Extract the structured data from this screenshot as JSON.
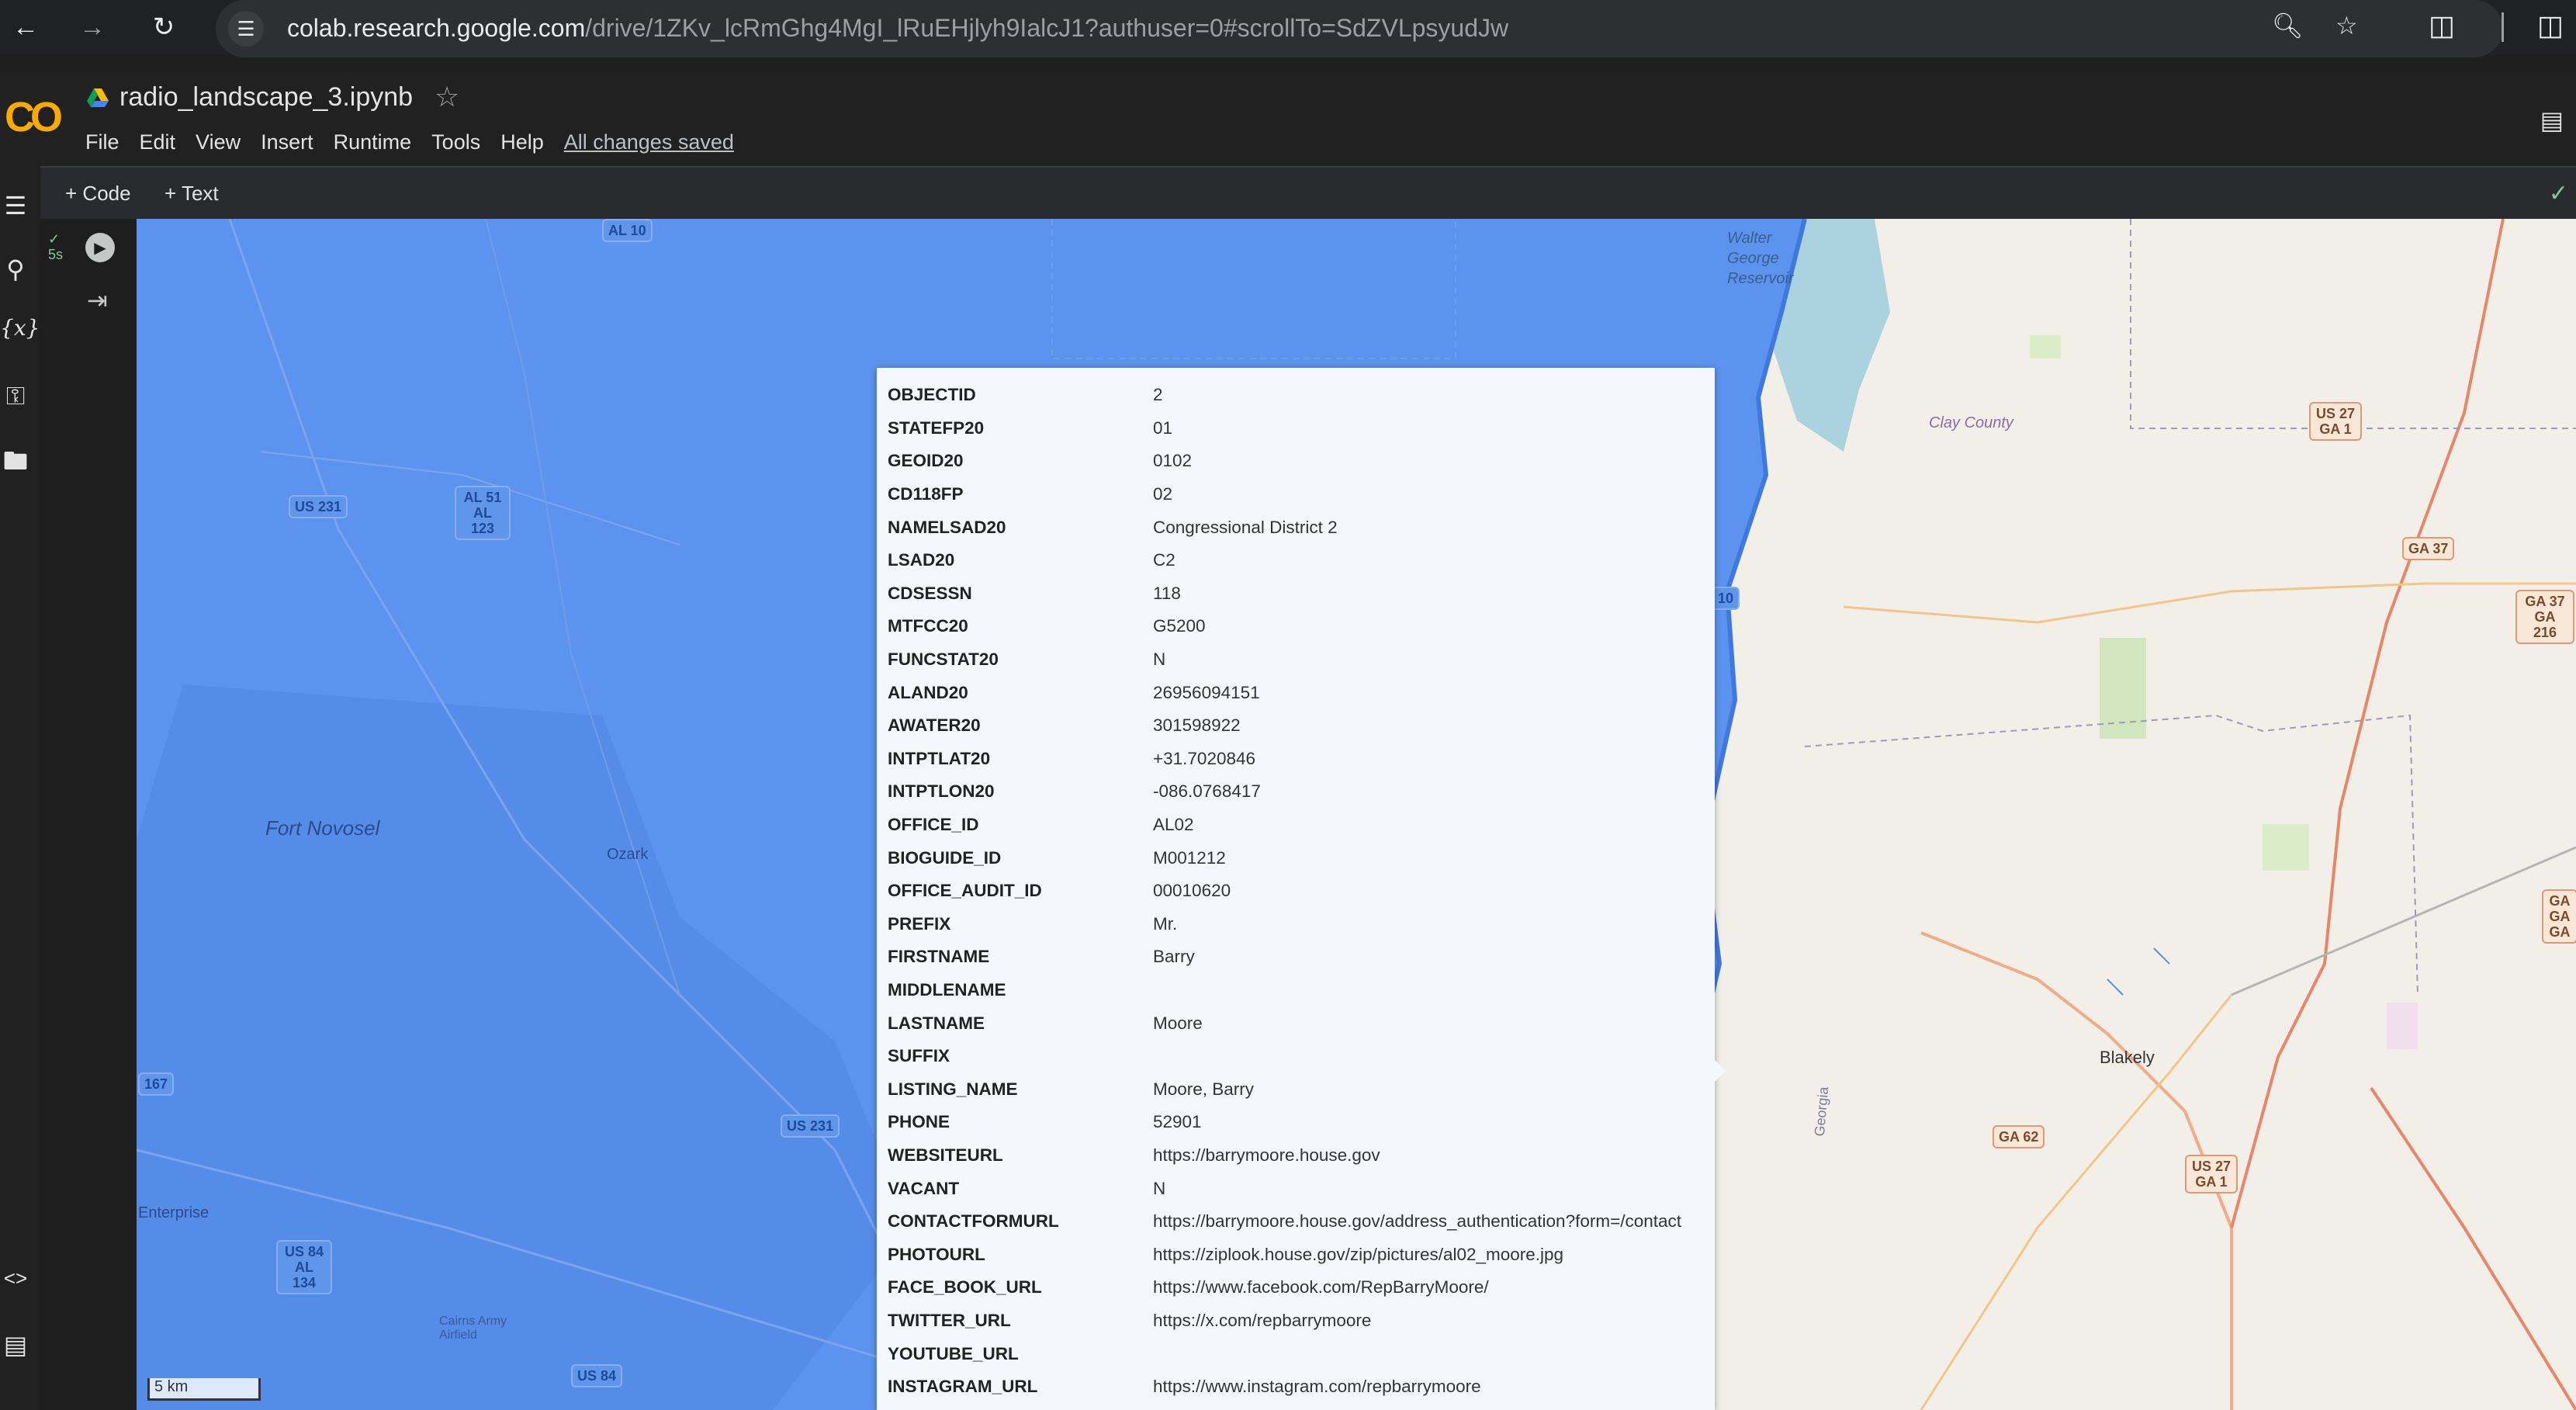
{
  "browser": {
    "url_host": "colab.research.google.com",
    "url_path": "/drive/1ZKv_lcRmGhg4MgI_lRuEHjlyh9IalcJ1?authuser=0#scrollTo=SdZVLpsyudJw"
  },
  "colab": {
    "logo_text": "CO",
    "notebook_name": "radio_landscape_3.ipynb",
    "menu": [
      "File",
      "Edit",
      "View",
      "Insert",
      "Runtime",
      "Tools",
      "Help"
    ],
    "save_status": "All changes saved",
    "toolbar": {
      "code_label": "Code",
      "text_label": "Text"
    },
    "cell": {
      "exec_time": "5s"
    }
  },
  "map": {
    "scale_label": "5 km",
    "labels": {
      "fort_novosel": "Fort Novosel",
      "ozark": "Ozark",
      "enterprise": "Enterprise",
      "cairns": "Cairns Army Airfield",
      "clay_county": "Clay County",
      "blakely": "Blakely",
      "walter_george": "Walter George Reservoir",
      "georgia": "Georgia"
    },
    "shields": {
      "us231_a": "US 231",
      "us231_b": "US 231",
      "al51": "AL 51 AL 123",
      "us84": "US 84 AL 134",
      "us84_b": "US 84",
      "al167": "167",
      "us27_a": "US 27 GA 1",
      "us27_b": "US 27 GA 1",
      "ga37": "GA 37",
      "ga37_216": "GA 37 GA 216",
      "ga62": "GA 62",
      "ga_edge": "GA GA GA",
      "al10": "AL 10",
      "r10": "10"
    }
  },
  "popup": {
    "rows": [
      {
        "key": "OBJECTID",
        "value": "2"
      },
      {
        "key": "STATEFP20",
        "value": "01"
      },
      {
        "key": "GEOID20",
        "value": "0102"
      },
      {
        "key": "CD118FP",
        "value": "02"
      },
      {
        "key": "NAMELSAD20",
        "value": "Congressional District 2"
      },
      {
        "key": "LSAD20",
        "value": "C2"
      },
      {
        "key": "CDSESSN",
        "value": "118"
      },
      {
        "key": "MTFCC20",
        "value": "G5200"
      },
      {
        "key": "FUNCSTAT20",
        "value": "N"
      },
      {
        "key": "ALAND20",
        "value": "26956094151"
      },
      {
        "key": "AWATER20",
        "value": "301598922"
      },
      {
        "key": "INTPTLAT20",
        "value": "+31.7020846"
      },
      {
        "key": "INTPTLON20",
        "value": "-086.0768417"
      },
      {
        "key": "OFFICE_ID",
        "value": "AL02"
      },
      {
        "key": "BIOGUIDE_ID",
        "value": "M001212"
      },
      {
        "key": "OFFICE_AUDIT_ID",
        "value": "00010620"
      },
      {
        "key": "PREFIX",
        "value": "Mr."
      },
      {
        "key": "FIRSTNAME",
        "value": "Barry"
      },
      {
        "key": "MIDDLENAME",
        "value": ""
      },
      {
        "key": "LASTNAME",
        "value": "Moore"
      },
      {
        "key": "SUFFIX",
        "value": ""
      },
      {
        "key": "LISTING_NAME",
        "value": "Moore, Barry"
      },
      {
        "key": "PHONE",
        "value": "52901"
      },
      {
        "key": "WEBSITEURL",
        "value": "https://barrymoore.house.gov"
      },
      {
        "key": "VACANT",
        "value": "N"
      },
      {
        "key": "CONTACTFORMURL",
        "value": "https://barrymoore.house.gov/address_authentication?form=/contact"
      },
      {
        "key": "PHOTOURL",
        "value": "https://ziplook.house.gov/zip/pictures/al02_moore.jpg"
      },
      {
        "key": "FACE_BOOK_URL",
        "value": "https://www.facebook.com/RepBarryMoore/"
      },
      {
        "key": "TWITTER_URL",
        "value": "https://x.com/repbarrymoore"
      },
      {
        "key": "YOUTUBE_URL",
        "value": ""
      },
      {
        "key": "INSTAGRAM_URL",
        "value": "https://www.instagram.com/repbarrymoore"
      }
    ]
  },
  "colors": {
    "district_fill": "#5c93ee",
    "colab_accent": "#f9ab00",
    "popup_bg": "#f4f8fd"
  }
}
